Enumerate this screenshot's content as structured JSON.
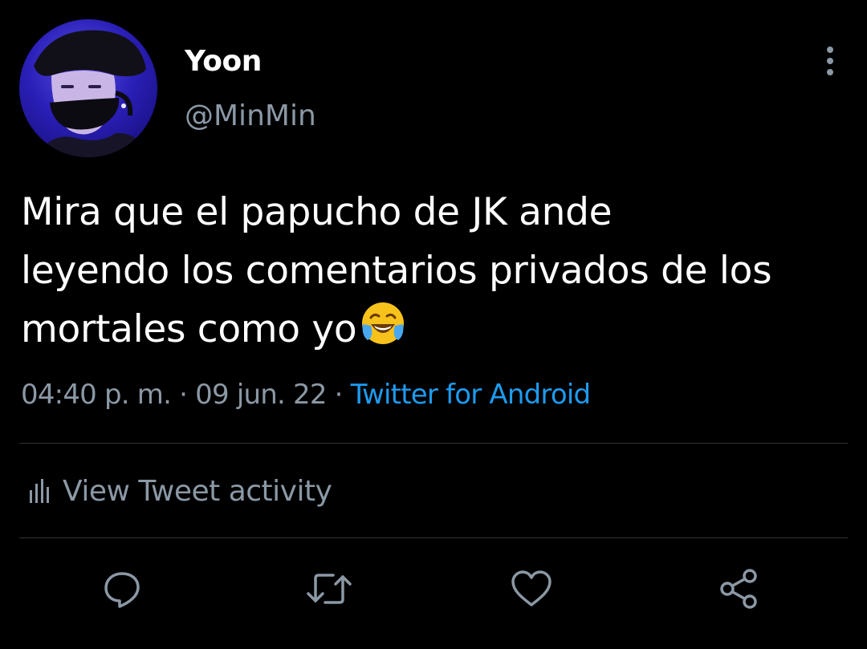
{
  "author": {
    "display_name": "Yoon",
    "handle": "@MinMin",
    "avatar_icon": "profile-photo"
  },
  "tweet": {
    "lines": [
      "Mira que el papucho de JK ande",
      "leyendo los comentarios privados de los",
      "mortales como yo"
    ],
    "emoji": "face-with-tears-of-joy"
  },
  "meta": {
    "time": "04:40 p. m.",
    "separator": " · ",
    "date": "09 jun. 22",
    "source": "Twitter for Android"
  },
  "activity": {
    "label": "View Tweet activity",
    "icon": "bar-chart-icon"
  },
  "actions": {
    "reply_icon": "comment-icon",
    "retweet_icon": "retweet-icon",
    "like_icon": "heart-icon",
    "share_icon": "share-icon"
  },
  "colors": {
    "background": "#000000",
    "text": "#ffffff",
    "secondary_text": "#8b98a5",
    "link": "#1d9bf0",
    "divider": "#2f3336"
  }
}
